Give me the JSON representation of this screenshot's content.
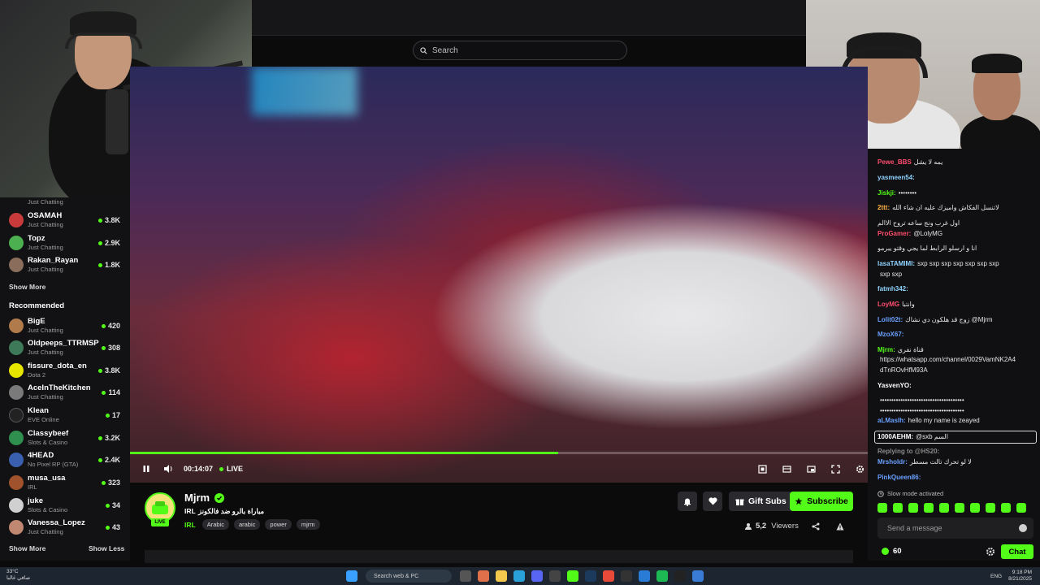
{
  "search": {
    "placeholder": "Search"
  },
  "sidebar": {
    "following": [
      {
        "category": "Just Chatting"
      },
      {
        "name": "OSAMAH",
        "category": "Just Chatting",
        "viewers": "3.8K",
        "color": "#c93b3b"
      },
      {
        "name": "Topz",
        "category": "Just Chatting",
        "viewers": "2.9K",
        "color": "#4caf50"
      },
      {
        "name": "Rakan_Rayan",
        "category": "Just Chatting",
        "viewers": "1.8K",
        "color": "#8a6d5a"
      }
    ],
    "show_more_1": "Show More",
    "recommended_label": "Recommended",
    "recommended": [
      {
        "name": "BigE",
        "category": "Just Chatting",
        "viewers": "420",
        "color": "#b07a4a"
      },
      {
        "name": "Oldpeeps_TTRMSP",
        "category": "Just Chatting",
        "viewers": "308",
        "color": "#3e7a5a"
      },
      {
        "name": "fissure_dota_en",
        "category": "Dota 2",
        "viewers": "3.8K",
        "color": "#e6e600"
      },
      {
        "name": "AceInTheKitchen",
        "category": "Just Chatting",
        "viewers": "114",
        "color": "#7a7a7a"
      },
      {
        "name": "Klean",
        "category": "EVE Online",
        "viewers": "17",
        "color": "#222222"
      },
      {
        "name": "Classybeef",
        "category": "Slots & Casino",
        "viewers": "3.2K",
        "color": "#2f8f4f"
      },
      {
        "name": "4HEAD",
        "category": "No Pixel RP (GTA)",
        "viewers": "2.4K",
        "color": "#3a5fae"
      },
      {
        "name": "musa_usa",
        "category": "IRL",
        "viewers": "323",
        "color": "#a0522d"
      },
      {
        "name": "juke",
        "category": "Slots & Casino",
        "viewers": "34",
        "color": "#d0d0d0"
      },
      {
        "name": "Vanessa_Lopez",
        "category": "Just Chatting",
        "viewers": "43",
        "color": "#c08870"
      }
    ],
    "show_more_2": "Show More",
    "show_less": "Show Less"
  },
  "player": {
    "time": "00:14:07",
    "live_label": "LIVE",
    "progress": 0.58
  },
  "streamer": {
    "name": "Mjrm",
    "live_badge": "LIVE",
    "category": "IRL",
    "title": "مباراة بالرو ضد فالكونز",
    "tags_category": "IRL",
    "tags": [
      "Arabic",
      "arabic",
      "power",
      "mjrm"
    ],
    "viewers": "5,2",
    "viewers_label": "Viewers",
    "gift_label": "Gift Subs",
    "subscribe_label": "Subscribe"
  },
  "chat": {
    "messages": [
      {
        "user": "Pewe_BBS",
        "text": "يمه لا يشل",
        "color": "#ff4d6d"
      },
      {
        "user": "yasmeen54:",
        "text": "",
        "color": "#8fd3ff"
      },
      {
        "user": "Jiskji:",
        "text": "••••••••",
        "color": "#53fc18"
      },
      {
        "user": "2ttt:",
        "text": "لاتنسل الفكاش واميزك عليه ان شاء الله",
        "color": "#ffb347"
      },
      {
        "user": "",
        "text": "اول غرب ونج ساعه تروح الاالم",
        "color": "#ffffff"
      },
      {
        "user": "ProGamer:",
        "text": "@LolyMG",
        "color": "#ff4d6d"
      },
      {
        "user": "",
        "text": "انا و ارسلو الرابط لما يجي وقتو يبرمو",
        "color": "#ffffff"
      },
      {
        "user": "lasaTAMIMI:",
        "text": "sxp sxp sxp sxp sxp sxp sxp",
        "color": "#8fd3ff"
      },
      {
        "user": "",
        "text": "sxp sxp",
        "color": "#ffffff"
      },
      {
        "user": "fatmh342:",
        "text": "",
        "color": "#8fd3ff"
      },
      {
        "user": "LoyMG",
        "text": "وانتبا",
        "color": "#ff4d6d"
      },
      {
        "user": "Lolit02t:",
        "text": "زوج قد هلكون دي نشاك @Mjrm",
        "color": "#6aa0ff"
      },
      {
        "user": "MzoX67:",
        "text": "",
        "color": "#6aa0ff"
      },
      {
        "user": "Mjrm:",
        "text": "قناة نفري",
        "color": "#53fc18"
      },
      {
        "user": "",
        "text": "https://whatsapp.com/channel/0029VamNK2A4",
        "color": "#ffffff"
      },
      {
        "user": "",
        "text": "dTnROvHfM93A",
        "color": "#ffffff"
      },
      {
        "user": "YasvenYO:",
        "text": "",
        "color": "#ffffff"
      },
      {
        "user": "",
        "text": "•••••••••••••••••••••••••••••••••••••",
        "color": "#ffffff"
      },
      {
        "user": "",
        "text": "•••••••••••••••••••••••••••••••••••••",
        "color": "#ffffff"
      },
      {
        "user": "aLMaslh:",
        "text": "hello my name is zeayed",
        "color": "#6aa0ff"
      },
      {
        "user": "1000AEHM:",
        "text": "@sxb السم",
        "color": "#ffffff"
      },
      {
        "user": "Replying to @HS20:",
        "text": "",
        "color": "#8a8a8a"
      },
      {
        "user": "Mrsholdr:",
        "text": "لا لو تحرك تالت مسطر",
        "color": "#6aa0ff"
      },
      {
        "user": "PinkQueen86:",
        "text": "",
        "color": "#6aa0ff"
      }
    ],
    "slow_mode": "Slow mode activated",
    "input_placeholder": "Send a message",
    "points": "60",
    "chat_button": "Chat"
  },
  "taskbar": {
    "weather_temp": "33°C",
    "weather_desc": "صافي غالبا",
    "search_placeholder": "Search web & PC",
    "lang": "ENG",
    "time": "9:18 PM",
    "date": "8/21/2025"
  },
  "colors": {
    "accent": "#53fc18",
    "background": "#0b0b0c"
  }
}
